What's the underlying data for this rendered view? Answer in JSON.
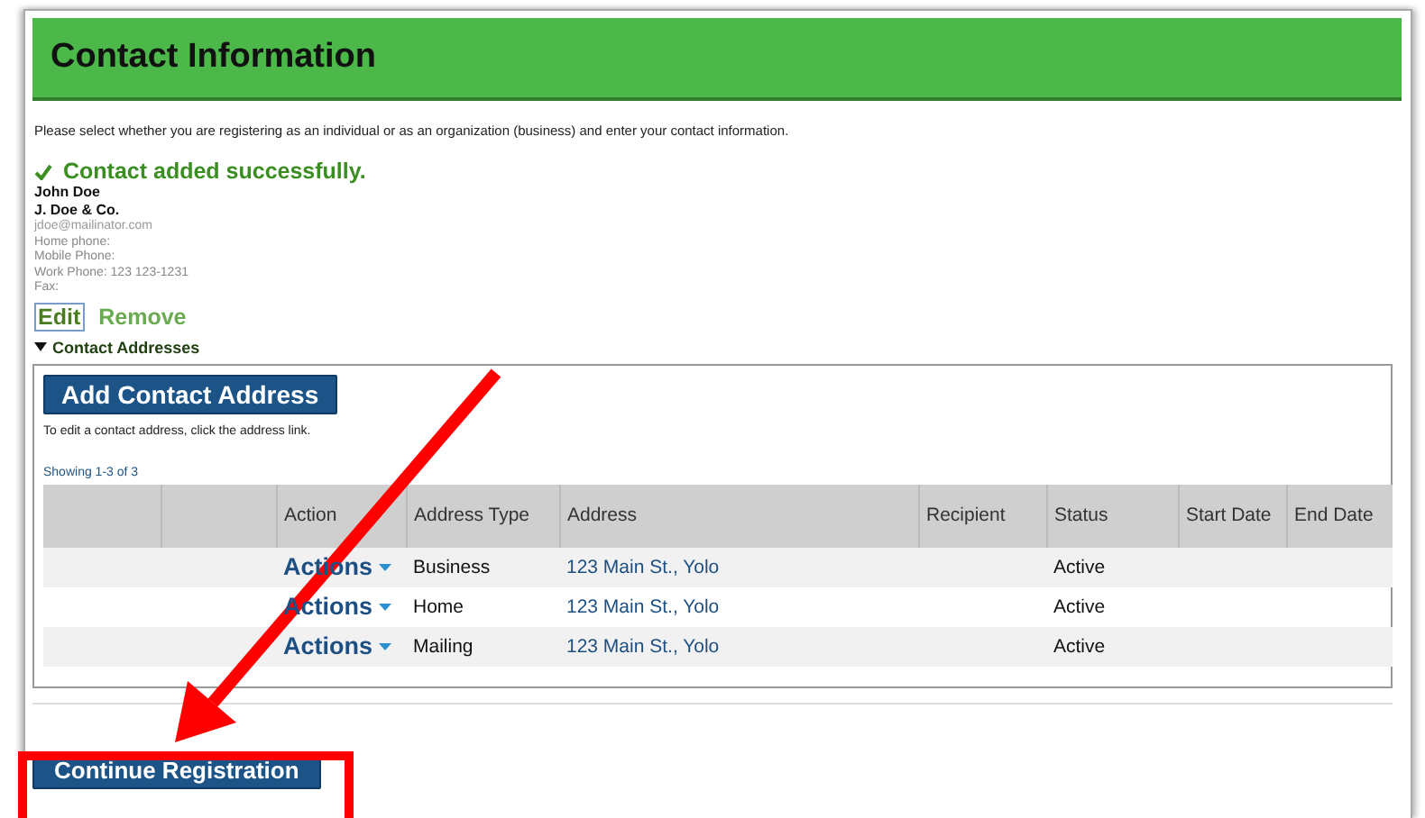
{
  "title": "Contact Information",
  "intro": "Please select whether you are registering as an individual or as an organization (business) and enter your contact information.",
  "success_message": "Contact added successfully.",
  "contact": {
    "name": "John Doe",
    "company": "J. Doe & Co.",
    "details": [
      "jdoe@mailinator.com",
      "Home phone:",
      "Mobile Phone:",
      "Work Phone: 123 123-1231",
      "Fax:"
    ]
  },
  "contact_links": [
    {
      "label": "Edit",
      "focused": true
    },
    {
      "label": "Remove",
      "focused": false
    }
  ],
  "contact_addresses": {
    "label": "Contact Addresses",
    "expanded": true,
    "add_button": "Add Contact Address",
    "hint": "To edit a contact address, click the address link.",
    "showing": "Showing 1-3 of 3",
    "table": {
      "columns": [
        "Action",
        "Address Type",
        "Address",
        "Recipient",
        "Status",
        "Start Date",
        "End Date"
      ],
      "rows": [
        {
          "action": "Actions",
          "address_type": "Business",
          "address": "123 Main St., Yolo",
          "status": "Active"
        },
        {
          "action": "Actions",
          "address_type": "Home",
          "address": "123 Main St., Yolo",
          "status": "Active"
        },
        {
          "action": "Actions",
          "address_type": "Mailing",
          "address": "123 Main St., Yolo",
          "status": "Active"
        }
      ]
    }
  },
  "continue_button": "Continue Registration"
}
